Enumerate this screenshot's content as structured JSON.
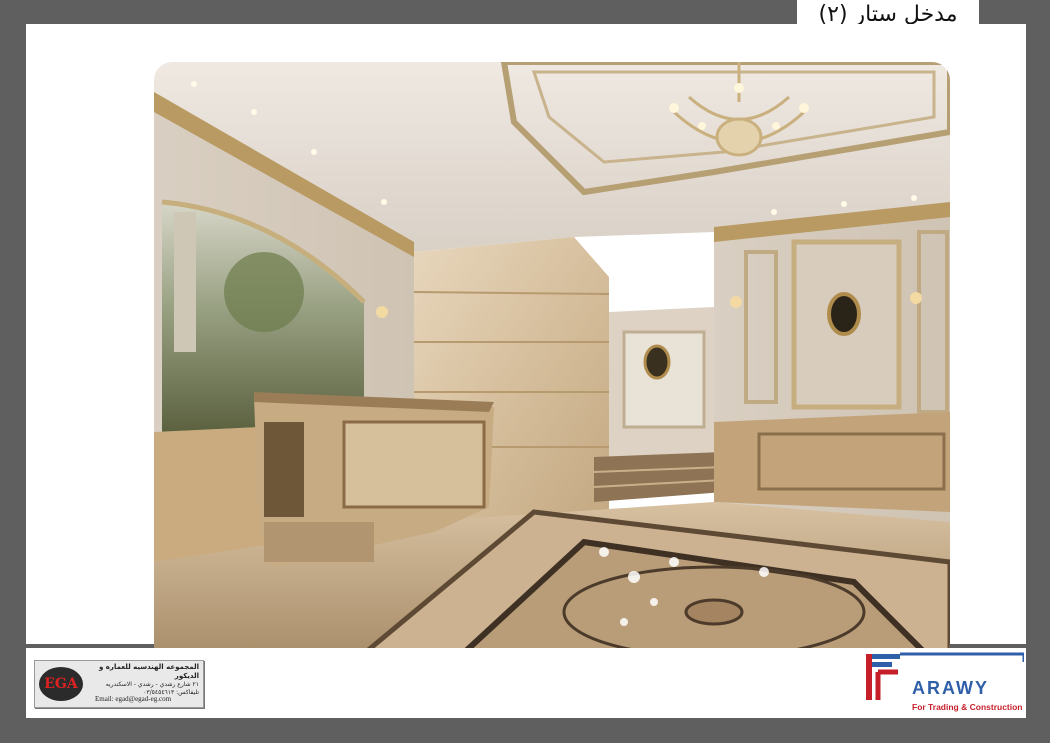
{
  "header": {
    "title": "مدخل ستار (٢)"
  },
  "render": {
    "description_icon": "lobby-entrance-render"
  },
  "footer": {
    "egad": {
      "logo_text": "EGA",
      "name": "المجموعه الهندسيه للعماره و الديكور",
      "address": "٢١ شارع رشدي - رشدي - الاسكندريه",
      "phone": "تليفاكس: ٠٣/٥٤٥٤٦١٣",
      "email": "Email: egad@egad-eg.com"
    },
    "farawy": {
      "wordmark": "ARAWY",
      "tagline": "For Trading & Construction",
      "colors": {
        "blue": "#2f5fa8",
        "red": "#c61f2a"
      }
    }
  },
  "colors": {
    "background": "#5f5f5f",
    "sheet": "#ffffff"
  }
}
